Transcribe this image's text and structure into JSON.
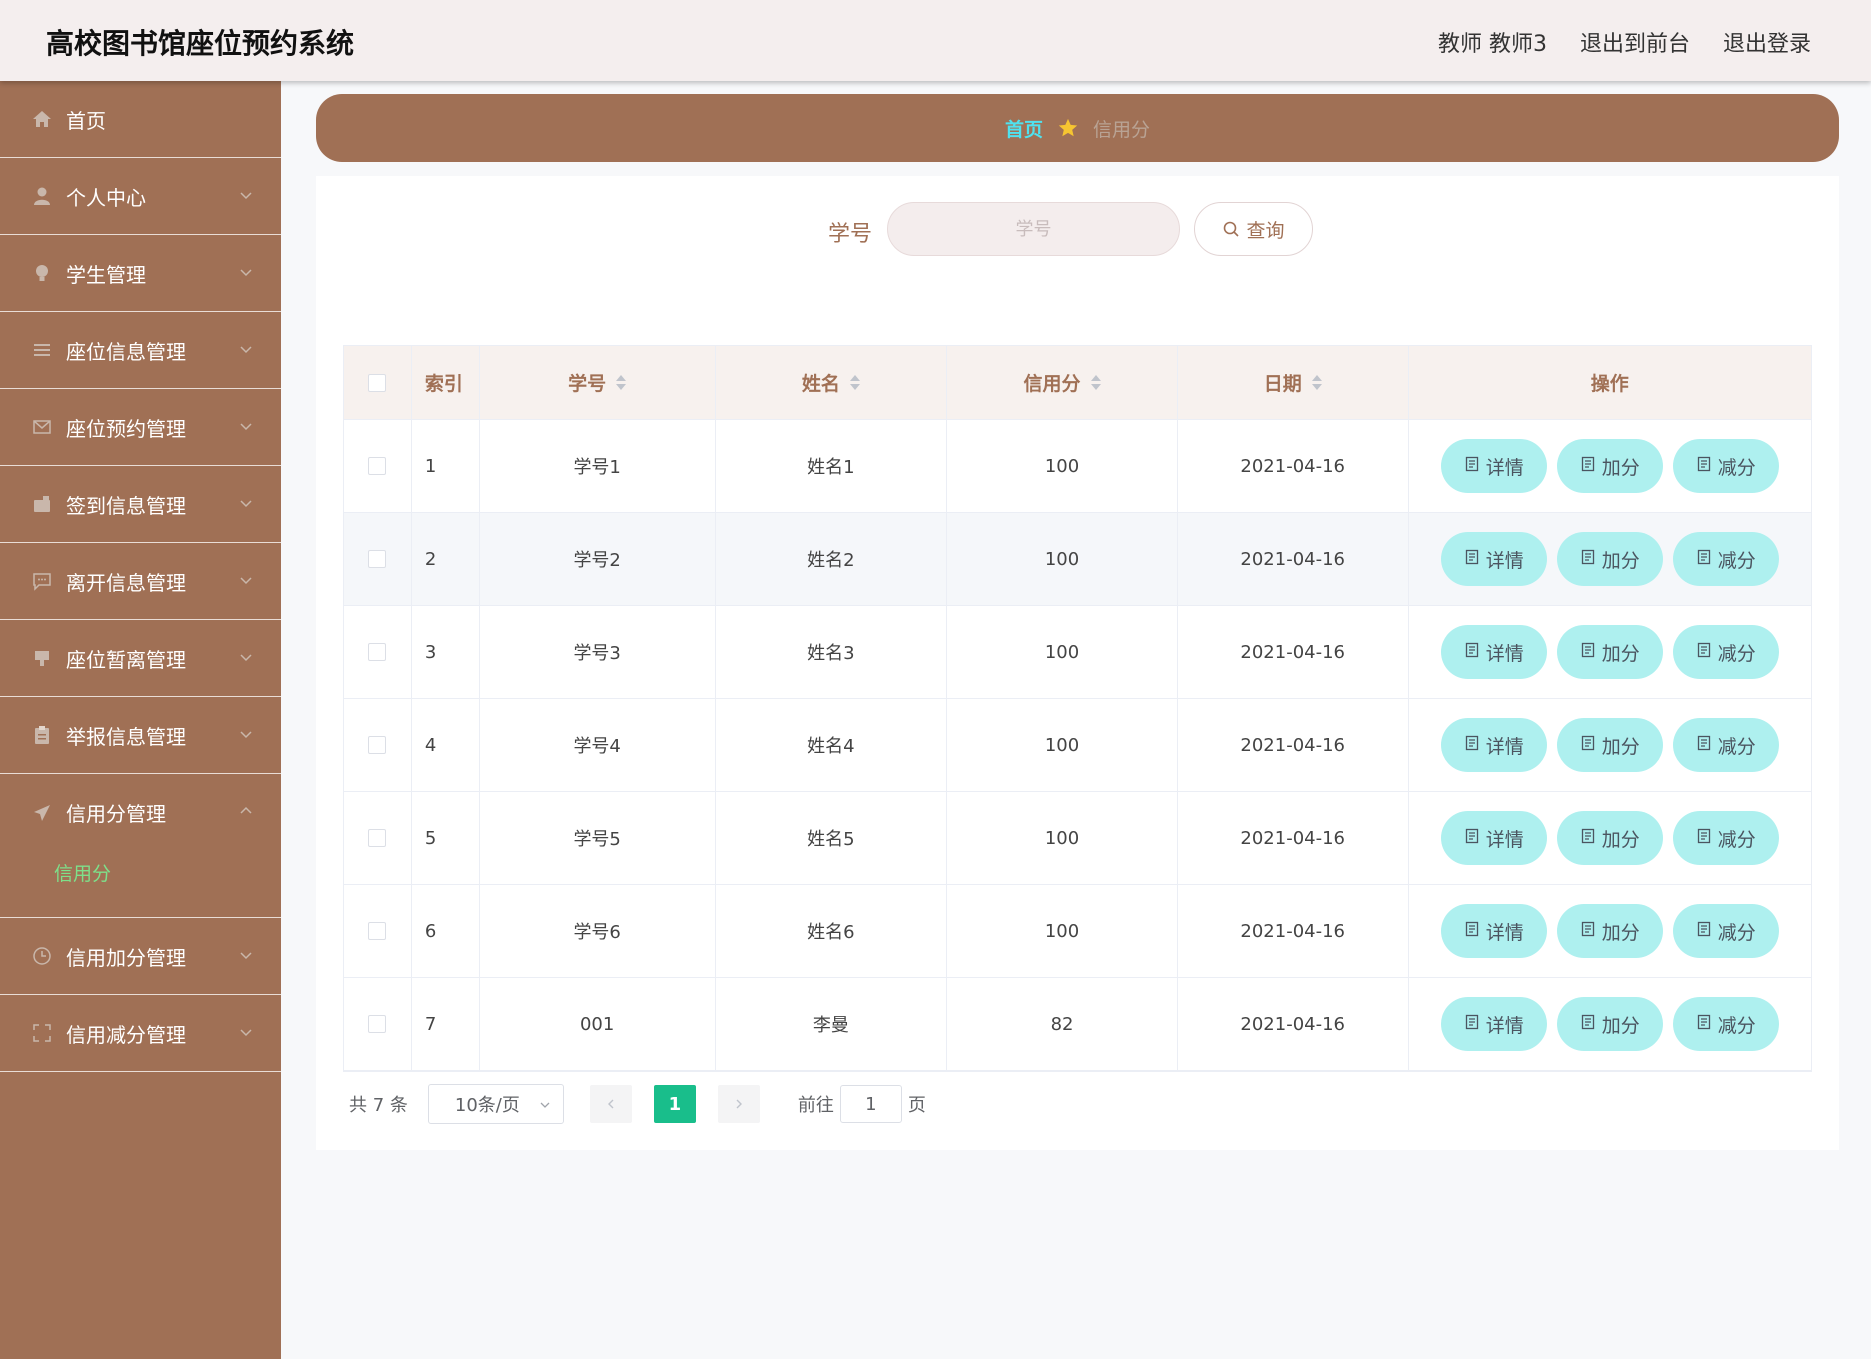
{
  "header": {
    "title": "高校图书馆座位预约系统",
    "user": "教师 教师3",
    "back_front": "退出到前台",
    "logout": "退出登录"
  },
  "sidebar": {
    "items": [
      {
        "label": "首页",
        "icon": "home-icon"
      },
      {
        "label": "个人中心",
        "icon": "user-icon"
      },
      {
        "label": "学生管理",
        "icon": "bulb-icon"
      },
      {
        "label": "座位信息管理",
        "icon": "menu-icon"
      },
      {
        "label": "座位预约管理",
        "icon": "mail-icon"
      },
      {
        "label": "签到信息管理",
        "icon": "wallet-icon"
      },
      {
        "label": "离开信息管理",
        "icon": "chat-icon"
      },
      {
        "label": "座位暂离管理",
        "icon": "stamp-icon"
      },
      {
        "label": "举报信息管理",
        "icon": "clipboard-icon"
      },
      {
        "label": "信用分管理",
        "icon": "send-icon"
      },
      {
        "label": "信用加分管理",
        "icon": "clock-icon"
      },
      {
        "label": "信用减分管理",
        "icon": "fullscreen-icon"
      }
    ],
    "submenu_active": "信用分",
    "active_color": "#7ee08a"
  },
  "breadcrumb": {
    "home": "首页",
    "current": "信用分"
  },
  "search": {
    "label": "学号",
    "placeholder": "学号",
    "button": "查询"
  },
  "table": {
    "columns": [
      "索引",
      "学号",
      "姓名",
      "信用分",
      "日期",
      "操作"
    ],
    "rows": [
      {
        "index": "1",
        "id": "学号1",
        "name": "姓名1",
        "score": "100",
        "date": "2021-04-16"
      },
      {
        "index": "2",
        "id": "学号2",
        "name": "姓名2",
        "score": "100",
        "date": "2021-04-16"
      },
      {
        "index": "3",
        "id": "学号3",
        "name": "姓名3",
        "score": "100",
        "date": "2021-04-16"
      },
      {
        "index": "4",
        "id": "学号4",
        "name": "姓名4",
        "score": "100",
        "date": "2021-04-16"
      },
      {
        "index": "5",
        "id": "学号5",
        "name": "姓名5",
        "score": "100",
        "date": "2021-04-16"
      },
      {
        "index": "6",
        "id": "学号6",
        "name": "姓名6",
        "score": "100",
        "date": "2021-04-16"
      },
      {
        "index": "7",
        "id": "001",
        "name": "李曼",
        "score": "82",
        "date": "2021-04-16"
      }
    ],
    "actions": {
      "detail": "详情",
      "add": "加分",
      "sub": "减分"
    }
  },
  "pagination": {
    "total": "共 7 条",
    "page_size": "10条/页",
    "current_page": "1",
    "goto_label": "前往",
    "goto_value": "1",
    "page_suffix": "页"
  },
  "colors": {
    "brand": "#a07055",
    "accent": "#4fe2ef",
    "button": "#aef0ef",
    "page_active": "#19be8b"
  }
}
